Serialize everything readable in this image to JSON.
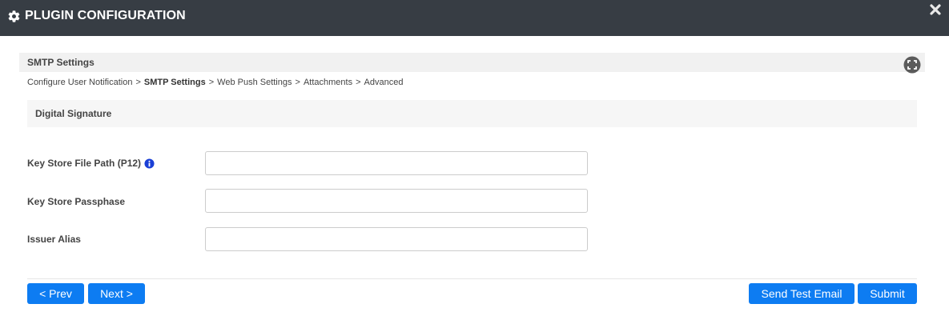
{
  "window": {
    "title": "PLUGIN CONFIGURATION",
    "title_icon": "gear-icon",
    "close_icon": "close-icon"
  },
  "section": {
    "title": "SMTP Settings",
    "expand_icon": "expand-icon"
  },
  "breadcrumb": [
    {
      "label": "Configure User Notification",
      "current": false
    },
    {
      "label": "SMTP Settings",
      "current": true
    },
    {
      "label": "Web Push Settings",
      "current": false
    },
    {
      "label": "Attachments",
      "current": false
    },
    {
      "label": "Advanced",
      "current": false
    }
  ],
  "breadcrumb_separator": ">",
  "panel": {
    "title": "Digital Signature"
  },
  "fields": {
    "key_store_path": {
      "label": "Key Store File Path (P12)",
      "value": "",
      "placeholder": "",
      "info_icon": "info-icon"
    },
    "key_store_passphrase": {
      "label": "Key Store Passphase",
      "value": "",
      "placeholder": ""
    },
    "issuer_alias": {
      "label": "Issuer Alias",
      "value": "",
      "placeholder": ""
    }
  },
  "buttons": {
    "prev": "< Prev",
    "next": "Next >",
    "send_test_email": "Send Test Email",
    "submit": "Submit"
  },
  "colors": {
    "titlebar_bg": "#373d44",
    "button_bg": "#0d7cf2",
    "info_icon": "#1a3fd6"
  }
}
